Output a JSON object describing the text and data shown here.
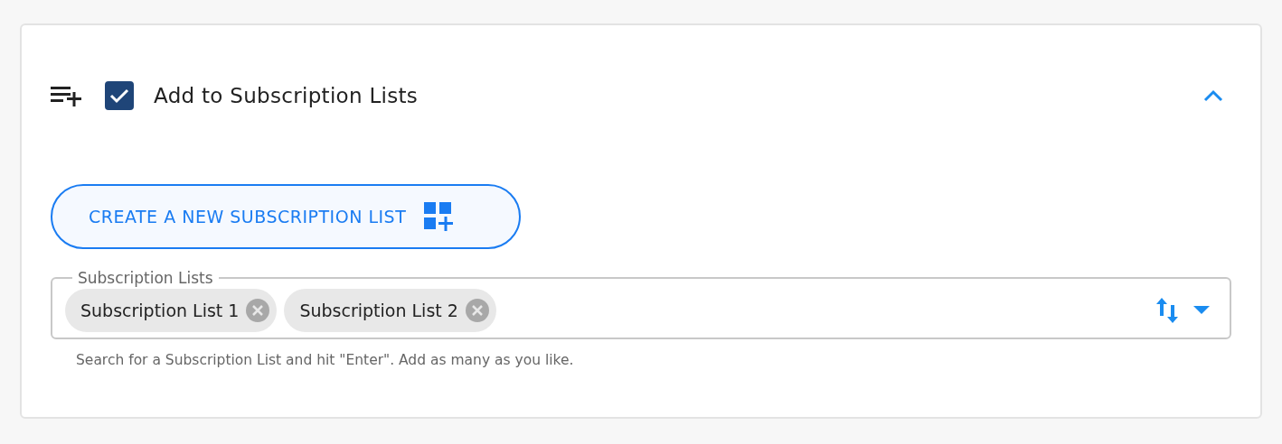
{
  "section": {
    "title": "Add to Subscription Lists",
    "checked": true,
    "expanded": true
  },
  "create_button": {
    "label": "CREATE A NEW SUBSCRIPTION LIST"
  },
  "field": {
    "label": "Subscription Lists",
    "chips": [
      {
        "label": "Subscription List 1"
      },
      {
        "label": "Subscription List 2"
      }
    ],
    "helper": "Search for a Subscription List and hit \"Enter\". Add as many as you like."
  }
}
